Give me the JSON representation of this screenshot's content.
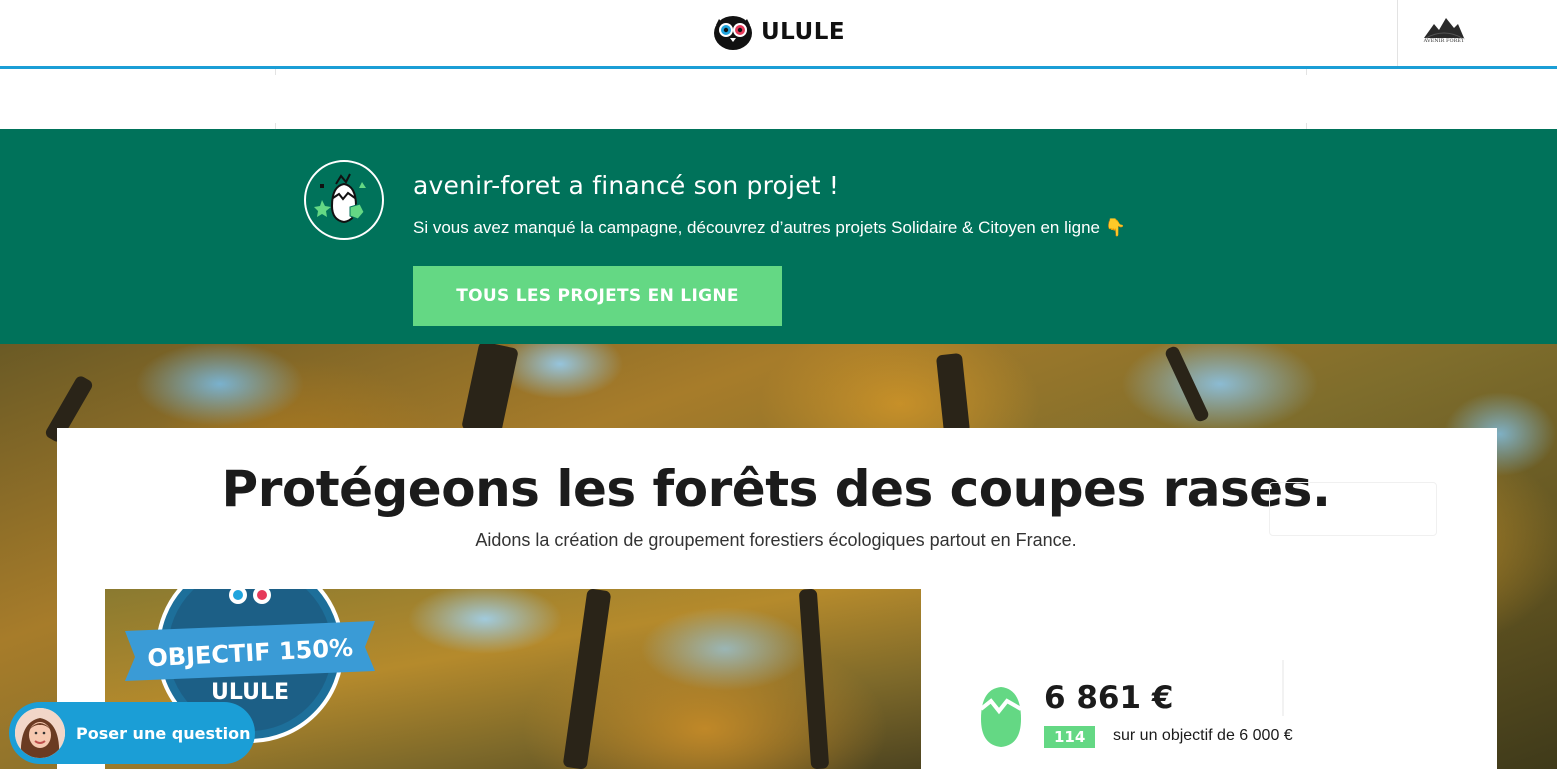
{
  "header": {
    "logo_text": "ULULE",
    "org_avatar_text": "AVENIR FORÊT"
  },
  "banner": {
    "title": "avenir-foret a financé son projet !",
    "subtitle": "Si vous avez manqué la campagne, découvrez d’autres projets Solidaire & Citoyen en ligne 👇",
    "button_label": "TOUS LES PROJETS EN LIGNE",
    "badge_icon": "hatching-egg-icon",
    "bg_color": "#00725a",
    "button_color": "#64d884"
  },
  "project": {
    "title": "Protégeons les forêts des coupes rases.",
    "subtitle": "Aidons la création de groupement forestiers écologiques partout en France.",
    "seal_line1": "OBJECTIF 150%",
    "seal_line2": "ULULE"
  },
  "stats": {
    "amount": "6 861 €",
    "percent": "114 %",
    "goal": "sur un objectif de 6 000 €",
    "egg_icon": "cracked-egg-icon"
  },
  "chat": {
    "label": "Poser une question",
    "color": "#1b9ed6"
  },
  "accent_color": "#1b9ed6"
}
